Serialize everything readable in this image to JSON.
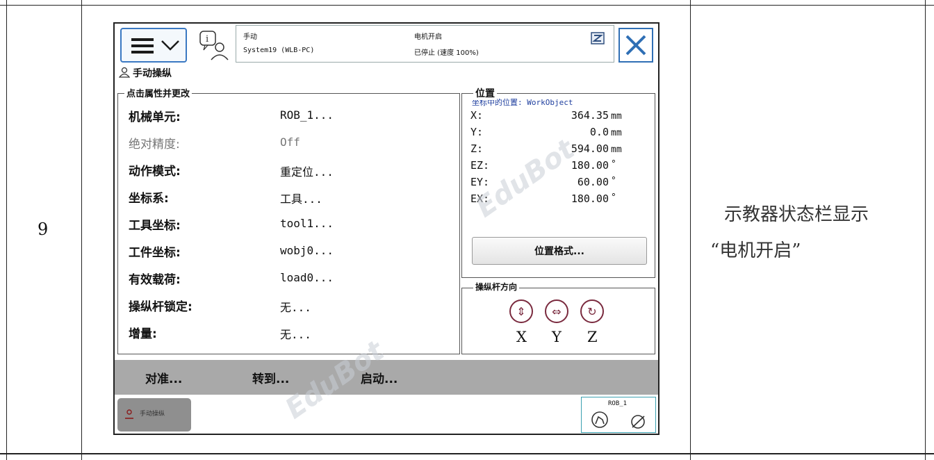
{
  "table": {
    "row_number": "9",
    "description_line1": "示教器状态栏显示",
    "description_line2": "“电机开启”"
  },
  "pendant": {
    "status_bar": {
      "mode": "手动",
      "system": "System19 (WLB-PC)",
      "motor_state": "电机开启",
      "run_state": "已停止 (速度 100%)"
    },
    "window_title": "手动操纵",
    "properties_group_title": "点击属性并更改",
    "properties": [
      {
        "label": "机械单元:",
        "value": "ROB_1...",
        "disabled": false
      },
      {
        "label": "绝对精度:",
        "value": "Off",
        "disabled": true
      },
      {
        "label": "动作模式:",
        "value": "重定位...",
        "disabled": false
      },
      {
        "label": "坐标系:",
        "value": "工具...",
        "disabled": false
      },
      {
        "label": "工具坐标:",
        "value": "tool1...",
        "disabled": false
      },
      {
        "label": "工件坐标:",
        "value": "wobj0...",
        "disabled": false
      },
      {
        "label": "有效载荷:",
        "value": "load0...",
        "disabled": false
      },
      {
        "label": "操纵杆锁定:",
        "value": "无...",
        "disabled": false
      },
      {
        "label": "增量:",
        "value": "无...",
        "disabled": false
      }
    ],
    "position": {
      "group_title": "位置",
      "frame_label": "坐标中的位置: WorkObject",
      "rows": [
        {
          "label": "X:",
          "value": "364.35",
          "unit": "mm"
        },
        {
          "label": "Y:",
          "value": "0.0",
          "unit": "mm"
        },
        {
          "label": "Z:",
          "value": "594.00",
          "unit": "mm"
        },
        {
          "label": "EZ:",
          "value": "180.00",
          "unit": "°"
        },
        {
          "label": "EY:",
          "value": "60.00",
          "unit": "°"
        },
        {
          "label": "EX:",
          "value": "180.00",
          "unit": "°"
        }
      ],
      "format_button": "位置格式..."
    },
    "joystick": {
      "group_title": "操纵杆方向",
      "axes": [
        "X",
        "Y",
        "Z"
      ]
    },
    "commands": {
      "align": "对准...",
      "goto": "转到...",
      "start": "启动..."
    },
    "taskbar": {
      "manual_tab": "手动操纵",
      "rob_label": "ROB_1"
    },
    "watermark": "EduBot",
    "colors": {
      "accent_blue": "#3a78c2",
      "command_bar": "#a9a9a9",
      "joystick_icon": "#7a2a3e",
      "disabled_text": "#777777"
    }
  }
}
